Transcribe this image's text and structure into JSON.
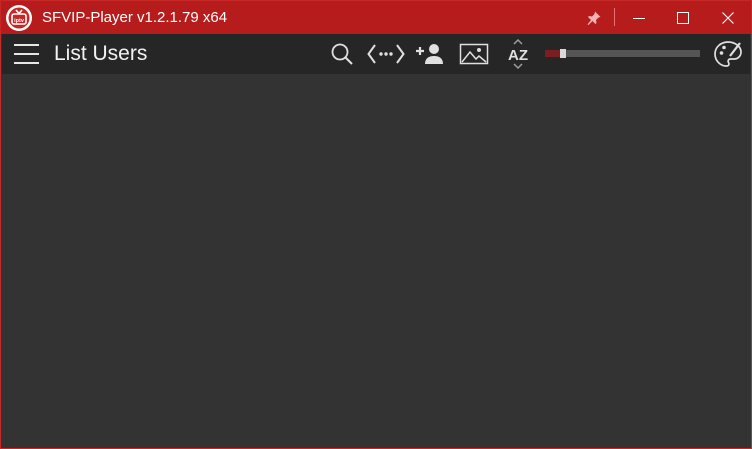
{
  "window": {
    "title": "SFVIP-Player v1.2.1.79 x64",
    "logo_text": "iptv",
    "colors": {
      "titlebar": "#b71c1c",
      "toolbar": "#262626",
      "content": "#333333"
    }
  },
  "titlebar": {
    "buttons": [
      {
        "name": "pin",
        "icon": "pin-icon"
      },
      {
        "name": "minimize",
        "icon": "minimize-icon"
      },
      {
        "name": "maximize",
        "icon": "maximize-icon"
      },
      {
        "name": "close",
        "icon": "close-icon"
      }
    ]
  },
  "toolbar": {
    "page_title": "List Users",
    "sort_label": "AZ",
    "icons": [
      "menu-icon",
      "search-icon",
      "code-icon",
      "add-user-icon",
      "image-icon",
      "sort-az-icon",
      "palette-icon"
    ],
    "slider": {
      "value": 0.1
    }
  }
}
